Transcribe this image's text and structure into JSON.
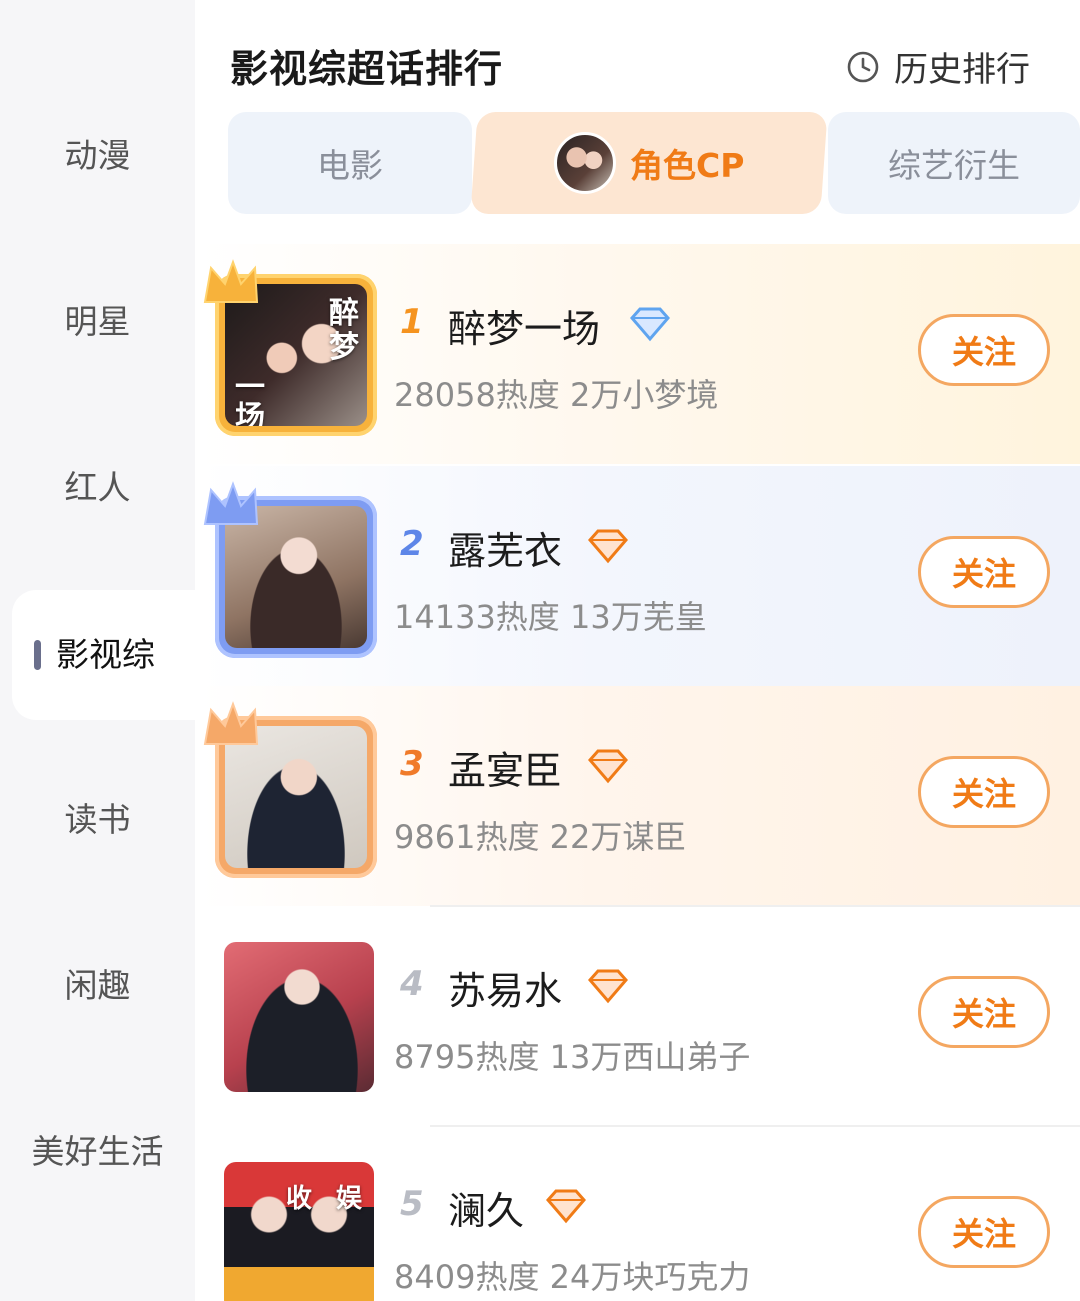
{
  "sidebar": {
    "items": [
      {
        "label": "动漫",
        "active": false
      },
      {
        "label": "明星",
        "active": false
      },
      {
        "label": "红人",
        "active": false
      },
      {
        "label": "影视综",
        "active": true
      },
      {
        "label": "读书",
        "active": false
      },
      {
        "label": "闲趣",
        "active": false
      },
      {
        "label": "美好生活",
        "active": false
      }
    ]
  },
  "header": {
    "title": "影视综超话排行",
    "history_label": "历史排行"
  },
  "tabs": [
    {
      "label": "电影",
      "active": false
    },
    {
      "label": "角色CP",
      "active": true
    },
    {
      "label": "综艺衍生",
      "active": false
    }
  ],
  "ranking": [
    {
      "rank": "1",
      "name": "醉梦一场",
      "heat": "28058热度",
      "fans": "2万小梦境",
      "follow_label": "关注",
      "badge": "diamond-blue",
      "frame": "gold"
    },
    {
      "rank": "2",
      "name": "露芜衣",
      "heat": "14133热度",
      "fans": "13万芜皇",
      "follow_label": "关注",
      "badge": "diamond-orange",
      "frame": "blue"
    },
    {
      "rank": "3",
      "name": "孟宴臣",
      "heat": "9861热度",
      "fans": "22万谋臣",
      "follow_label": "关注",
      "badge": "diamond-orange",
      "frame": "orange"
    },
    {
      "rank": "4",
      "name": "苏易水",
      "heat": "8795热度",
      "fans": "13万西山弟子",
      "follow_label": "关注",
      "badge": "diamond-orange",
      "frame": "none"
    },
    {
      "rank": "5",
      "name": "澜久",
      "heat": "8409热度",
      "fans": "24万块巧克力",
      "follow_label": "关注",
      "badge": "diamond-orange",
      "frame": "none"
    }
  ],
  "thumb_captions": {
    "r1_a": "醉",
    "r1_b": "梦",
    "r1_c": "一",
    "r1_d": "场",
    "r5_a": "收",
    "r5_b": "娱"
  },
  "colors": {
    "accent": "#f07b16",
    "gold": "#f7b23b",
    "blue": "#7e9cf2",
    "orange": "#f5a868"
  }
}
